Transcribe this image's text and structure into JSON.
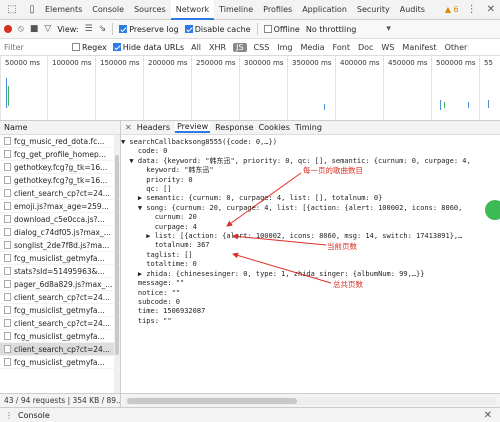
{
  "tabs": [
    "Elements",
    "Console",
    "Sources",
    "Network",
    "Timeline",
    "Profiles",
    "Application",
    "Security",
    "Audits"
  ],
  "active_tab": "Network",
  "warning_count": "▲ 6",
  "toolbar": {
    "view_label": "View:",
    "preserve_log": "Preserve log",
    "disable_cache": "Disable cache",
    "offline": "Offline",
    "throttling": "No throttling"
  },
  "filterbar": {
    "placeholder": "Filter",
    "regex": "Regex",
    "hide_data_urls": "Hide data URLs",
    "types": [
      "All",
      "XHR",
      "JS",
      "CSS",
      "Img",
      "Media",
      "Font",
      "Doc",
      "WS",
      "Manifest",
      "Other"
    ],
    "selected_type": "JS"
  },
  "timeline_ticks": [
    "50000 ms",
    "100000 ms",
    "150000 ms",
    "200000 ms",
    "250000 ms",
    "300000 ms",
    "350000 ms",
    "400000 ms",
    "450000 ms",
    "500000 ms",
    "55"
  ],
  "requests": {
    "header": "Name",
    "items": [
      "fcg_music_red_dota.fc...",
      "fcg_get_profile_homep...",
      "gethotkey.fcg?g_tk=16...",
      "gethotkey.fcg?g_tk=16...",
      "client_search_cp?ct=24...",
      "emoji.js?max_age=259...",
      "download_c5e0cca.js?...",
      "dialog_c74df05.js?max_...",
      "songlist_2de7f8d.js?ma...",
      "fcg_musiclist_getmyfa...",
      "stats?sId=51495963&...",
      "pager_6d8a829.js?max_...",
      "client_search_cp?ct=24...",
      "fcg_musiclist_getmyfa...",
      "client_search_cp?ct=24...",
      "fcg_musiclist_getmyfa...",
      "client_search_cp?ct=24...",
      "fcg_musiclist_getmyfa..."
    ],
    "selected_index": 16
  },
  "detail_tabs": [
    "Headers",
    "Preview",
    "Response",
    "Cookies",
    "Timing"
  ],
  "active_detail_tab": "Preview",
  "preview_lines": [
    "▼ searchCallbacksong8555({code: 0,…})",
    "    code: 0",
    "  ▼ data: {keyword: \"韩东迅\", priority: 0, qc: [], semantic: {curnum: 0, curpage: 4,",
    "      keyword: \"韩东迅\"",
    "      priority: 0",
    "      qc: []",
    "    ▶ semantic: {curnum: 0, curpage: 4, list: [], totalnum: 0}",
    "    ▼ song: {curnum: 20, curpage: 4, list: [{action: {alert: 100002, icons: 8060,",
    "        curnum: 20",
    "        curpage: 4",
    "      ▶ list: [{action: {alert: 100002, icons: 8060, msg: 14, switch: 17413891},…",
    "        totalnum: 367",
    "      taglist: []",
    "      totaltime: 0",
    "    ▶ zhida: {chinesesinger: 0, type: 1, zhida_singer: {albumNum: 99,…}}",
    "    message: \"\"",
    "    notice: \"\"",
    "    subcode: 0",
    "    time: 1506932087",
    "    tips: \"\""
  ],
  "annotations": {
    "per_page": "每一页的歌曲数目",
    "current_page": "当前页数",
    "total_pages": "总共页数"
  },
  "status_text": "43 / 94 requests | 354 KB / 89...",
  "drawer_label": "Console",
  "colors": {
    "accent": "#2c7be5",
    "annotation": "#d93025",
    "record": "#d93025"
  }
}
